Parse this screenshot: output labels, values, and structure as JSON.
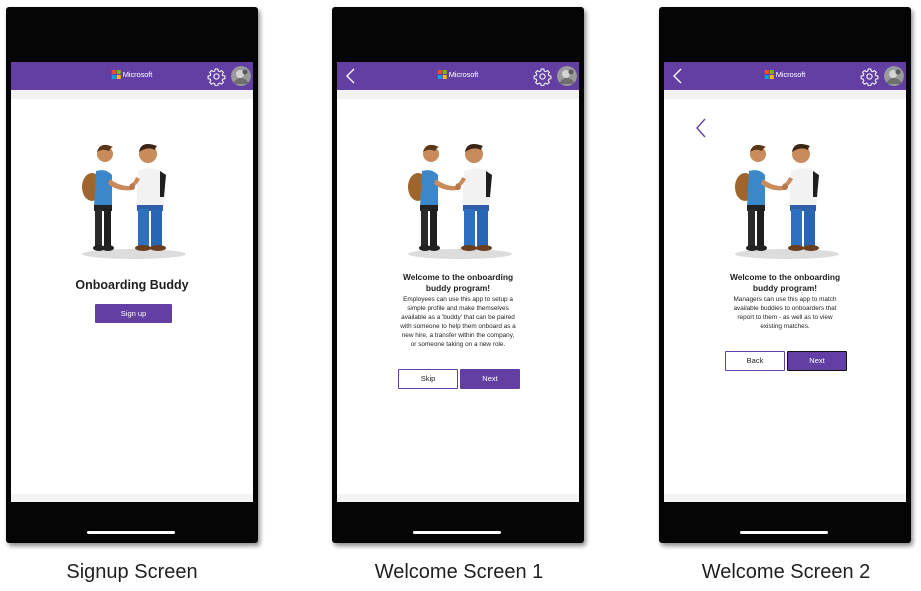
{
  "brand": {
    "name": "Microsoft",
    "accent": "#633fa3",
    "logo_colors": [
      "#f25022",
      "#7fba00",
      "#00a4ef",
      "#ffb900"
    ]
  },
  "icons": {
    "back": "chevron-left-icon",
    "settings": "gear-icon",
    "avatar": "user-avatar"
  },
  "signup": {
    "heading": "Onboarding Buddy",
    "signup_label": "Sign up",
    "caption": "Signup Screen"
  },
  "welcome1": {
    "title_line1": "Welcome to the onboarding",
    "title_line2": "buddy program!",
    "body_lines": [
      "Employees can use this app to setup a",
      "simple profile and make themselves",
      "available as a 'buddy' that can be paired",
      "with someone to help them onboard as a",
      "new hire, a transfer within the company,",
      "or someone taking on a new role."
    ],
    "skip_label": "Skip",
    "next_label": "Next",
    "caption": "Welcome Screen 1"
  },
  "welcome2": {
    "title_line1": "Welcome to the onboarding",
    "title_line2": "buddy program!",
    "body_lines": [
      "Managers can use this app to match",
      "available buddies to onboarders that",
      "report to them - as well as to view",
      "existing matches."
    ],
    "back_label": "Back",
    "next_label": "Next",
    "caption": "Welcome Screen 2"
  }
}
